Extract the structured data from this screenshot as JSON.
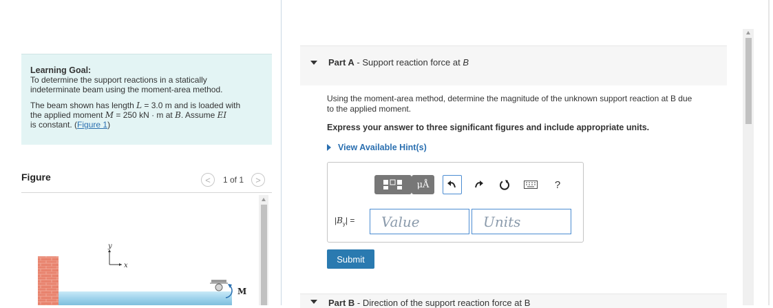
{
  "learning_goal": {
    "title": "Learning Goal:",
    "line1": "To determine the support reactions in a statically",
    "line2": "indeterminate beam using the moment-area method.",
    "p2_l1_a": "The beam shown has length ",
    "p2_l1_sym": "L",
    "p2_l1_b": " = 3.0 m  and is loaded with",
    "p2_l2_a": "the applied moment ",
    "p2_l2_sym": "M",
    "p2_l2_b": " = 250 kN · m at ",
    "p2_l2_c": "B",
    "p2_l2_d": ". Assume ",
    "p2_l2_e": "EI",
    "p2_l3": "is constant. (",
    "figure_link": "Figure 1",
    "p2_l3_end": ")"
  },
  "figure": {
    "title": "Figure",
    "page_count": "1 of 1",
    "prev_glyph": "<",
    "next_glyph": ">",
    "axis_y": "y",
    "axis_x": "x",
    "moment_label": "M"
  },
  "part_a": {
    "label": "Part A",
    "separator": " - ",
    "title": "Support reaction force at ",
    "title_var": "B",
    "question_line1": "Using the moment-area method, determine the magnitude of the unknown support reaction at B due",
    "question_line2": "to the applied moment.",
    "instruction": "Express your answer to three significant figures and include appropriate units.",
    "hint_link": "View Available Hint(s)",
    "toolbar": {
      "template_icon": "templates-icon",
      "units_label": "μÅ",
      "undo_icon": "undo-icon",
      "redo_icon": "redo-icon",
      "reset_icon": "reset-icon",
      "keyboard_icon": "keyboard-icon",
      "help_label": "?"
    },
    "answer_label_prefix": "|",
    "answer_label_var": "B",
    "answer_label_sub": "y",
    "answer_label_suffix": "| =",
    "value_placeholder": "Value",
    "units_placeholder": "Units",
    "submit_label": "Submit"
  },
  "part_b": {
    "label": "Part B",
    "separator": " - ",
    "title": "Direction of the support reaction force at B"
  },
  "colors": {
    "goal_bg": "#e3f4f4",
    "link": "#2a6fb0",
    "submit_bg": "#2a7ab0",
    "wall": "#e8836e",
    "beam": "#9fd3ec"
  }
}
